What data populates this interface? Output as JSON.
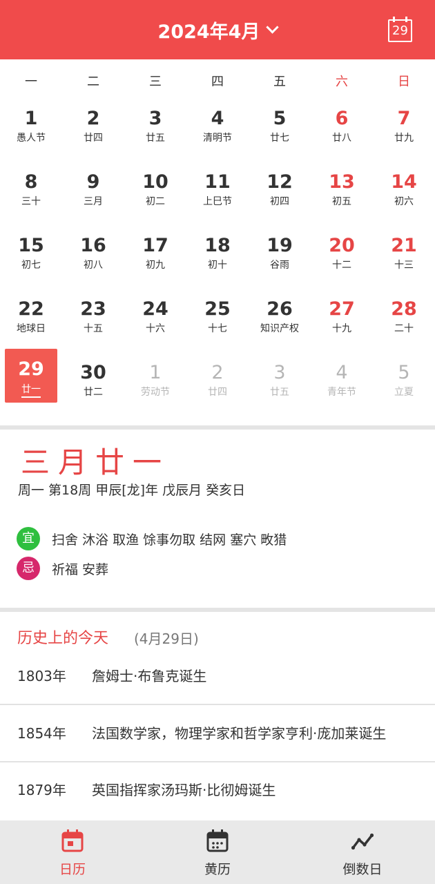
{
  "header": {
    "title": "2024年4月",
    "today_number": "29"
  },
  "colors": {
    "brand": "#f04b4b",
    "weekend": "#e64545",
    "yi": "#2fbf3f",
    "ji": "#d6286b"
  },
  "weekdays": [
    "一",
    "二",
    "三",
    "四",
    "五",
    "六",
    "日"
  ],
  "weeks": [
    [
      {
        "day": "1",
        "lunar": "愚人节"
      },
      {
        "day": "2",
        "lunar": "廿四"
      },
      {
        "day": "3",
        "lunar": "廿五"
      },
      {
        "day": "4",
        "lunar": "清明节"
      },
      {
        "day": "5",
        "lunar": "廿七"
      },
      {
        "day": "6",
        "lunar": "廿八"
      },
      {
        "day": "7",
        "lunar": "廿九"
      }
    ],
    [
      {
        "day": "8",
        "lunar": "三十"
      },
      {
        "day": "9",
        "lunar": "三月"
      },
      {
        "day": "10",
        "lunar": "初二"
      },
      {
        "day": "11",
        "lunar": "上巳节"
      },
      {
        "day": "12",
        "lunar": "初四"
      },
      {
        "day": "13",
        "lunar": "初五"
      },
      {
        "day": "14",
        "lunar": "初六"
      }
    ],
    [
      {
        "day": "15",
        "lunar": "初七"
      },
      {
        "day": "16",
        "lunar": "初八"
      },
      {
        "day": "17",
        "lunar": "初九"
      },
      {
        "day": "18",
        "lunar": "初十"
      },
      {
        "day": "19",
        "lunar": "谷雨"
      },
      {
        "day": "20",
        "lunar": "十二"
      },
      {
        "day": "21",
        "lunar": "十三"
      }
    ],
    [
      {
        "day": "22",
        "lunar": "地球日"
      },
      {
        "day": "23",
        "lunar": "十五"
      },
      {
        "day": "24",
        "lunar": "十六"
      },
      {
        "day": "25",
        "lunar": "十七"
      },
      {
        "day": "26",
        "lunar": "知识产权"
      },
      {
        "day": "27",
        "lunar": "十九"
      },
      {
        "day": "28",
        "lunar": "二十"
      }
    ],
    [
      {
        "day": "29",
        "lunar": "廿一"
      },
      {
        "day": "30",
        "lunar": "廿二"
      },
      {
        "day": "1",
        "lunar": "劳动节"
      },
      {
        "day": "2",
        "lunar": "廿四"
      },
      {
        "day": "3",
        "lunar": "廿五"
      },
      {
        "day": "4",
        "lunar": "青年节"
      },
      {
        "day": "5",
        "lunar": "立夏"
      }
    ]
  ],
  "detail": {
    "lunar_date": "三月廿一",
    "info": "周一 第18周 甲辰[龙]年 戊辰月 癸亥日",
    "yi_label": "宜",
    "yi_text": "扫舍 沐浴 取渔 馀事勿取 结网 塞穴 畋猎",
    "ji_label": "忌",
    "ji_text": "祈福 安葬"
  },
  "history": {
    "title": "历史上的今天",
    "date": "(4月29日)",
    "events": [
      {
        "year": "1803年",
        "text": "詹姆士·布鲁克诞生"
      },
      {
        "year": "1854年",
        "text": "法国数学家，物理学家和哲学家亨利·庞加莱诞生"
      },
      {
        "year": "1879年",
        "text": "英国指挥家汤玛斯·比彻姆诞生"
      }
    ]
  },
  "tabs": [
    {
      "label": "日历",
      "icon": "calendar-icon"
    },
    {
      "label": "黄历",
      "icon": "almanac-icon"
    },
    {
      "label": "倒数日",
      "icon": "countdown-icon"
    }
  ]
}
